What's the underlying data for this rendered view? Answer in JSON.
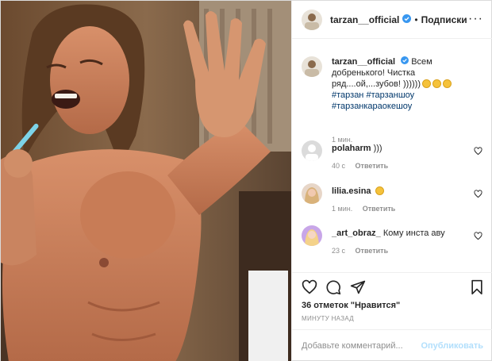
{
  "post": {
    "username": "tarzan__official",
    "dot": "•",
    "follow_label": "Подписки",
    "more_label": "···",
    "caption": {
      "username": "tarzan__official",
      "text": "Всем добренького! Чистка ряд....ой,...зубов! ))))))",
      "hashtags": [
        "#тарзан",
        "#тарзаншоу",
        "#тарзанкараокешоу"
      ],
      "time": "1 мин."
    },
    "comments": [
      {
        "username": "polaharm",
        "text": ")))",
        "time": "40 с",
        "reply": "Ответить"
      },
      {
        "username": "lilia.esina",
        "text": "",
        "time": "1 мин.",
        "reply": "Ответить"
      },
      {
        "username": "_art_obraz_",
        "text": "Кому инста аву",
        "time": "23 с",
        "reply": "Ответить"
      }
    ],
    "likes": "36 отметок \"Нравится\"",
    "time_ago": "МИНУТУ НАЗАД",
    "add_comment_placeholder": "Добавьте комментарий...",
    "publish_label": "Опубликовать"
  },
  "colors": {
    "accent": "#0095f6",
    "verified": "#3897f0",
    "link": "#00376b",
    "muted": "#8e8e8e",
    "publish_disabled": "#b2dffc"
  }
}
